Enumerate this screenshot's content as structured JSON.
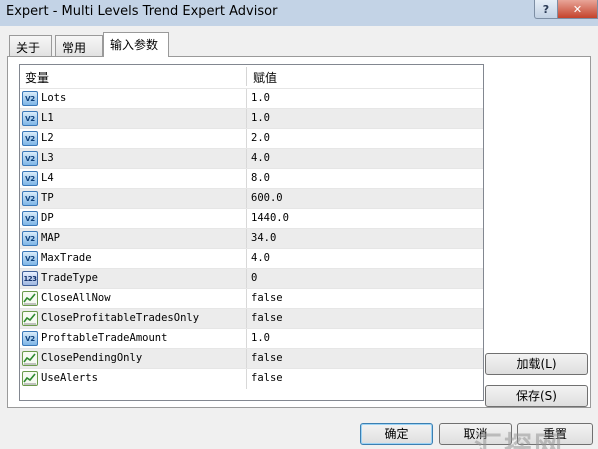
{
  "window": {
    "title": "Expert - Multi Levels Trend Expert Advisor",
    "help_glyph": "?",
    "close_glyph": "✕"
  },
  "tabs": [
    {
      "label": "关于"
    },
    {
      "label": "常用"
    },
    {
      "label": "输入参数"
    }
  ],
  "grid": {
    "headers": {
      "variable": "变量",
      "value": "赋值"
    },
    "rows": [
      {
        "icon": "double-value-icon",
        "icon_text": "V2",
        "name": "Lots",
        "value": "1.0"
      },
      {
        "icon": "double-value-icon",
        "icon_text": "V2",
        "name": "L1",
        "value": "1.0"
      },
      {
        "icon": "double-value-icon",
        "icon_text": "V2",
        "name": "L2",
        "value": "2.0"
      },
      {
        "icon": "double-value-icon",
        "icon_text": "V2",
        "name": "L3",
        "value": "4.0"
      },
      {
        "icon": "double-value-icon",
        "icon_text": "V2",
        "name": "L4",
        "value": "8.0"
      },
      {
        "icon": "double-value-icon",
        "icon_text": "V2",
        "name": "TP",
        "value": "600.0"
      },
      {
        "icon": "double-value-icon",
        "icon_text": "V2",
        "name": "DP",
        "value": "1440.0"
      },
      {
        "icon": "double-value-icon",
        "icon_text": "V2",
        "name": "MAP",
        "value": "34.0"
      },
      {
        "icon": "double-value-icon",
        "icon_text": "V2",
        "name": "MaxTrade",
        "value": "4.0"
      },
      {
        "icon": "integer-value-icon",
        "icon_text": "123",
        "name": "TradeType",
        "value": "0"
      },
      {
        "icon": "boolean-value-icon",
        "icon_text": "",
        "name": "CloseAllNow",
        "value": "false"
      },
      {
        "icon": "boolean-value-icon",
        "icon_text": "",
        "name": "CloseProfitableTradesOnly",
        "value": "false"
      },
      {
        "icon": "double-value-icon",
        "icon_text": "V2",
        "name": "ProftableTradeAmount",
        "value": "1.0"
      },
      {
        "icon": "boolean-value-icon",
        "icon_text": "",
        "name": "ClosePendingOnly",
        "value": "false"
      },
      {
        "icon": "boolean-value-icon",
        "icon_text": "",
        "name": "UseAlerts",
        "value": "false"
      }
    ]
  },
  "buttons": {
    "load": "加载(L)",
    "save": "保存(S)",
    "ok": "确定",
    "cancel": "取消",
    "reset": "重置"
  },
  "watermark": "汇探网"
}
